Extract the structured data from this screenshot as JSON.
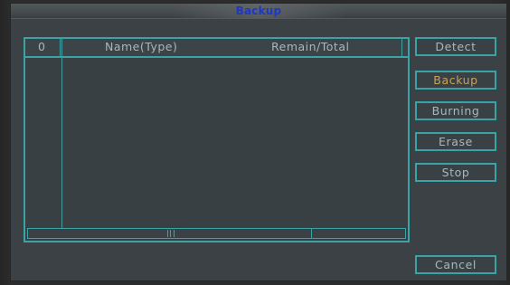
{
  "window": {
    "title": "Backup"
  },
  "device_list": {
    "columns": [
      "0",
      "Name(Type)",
      "Remain/Total"
    ],
    "rows": []
  },
  "buttons": {
    "detect": "Detect",
    "backup": "Backup",
    "burning": "Burning",
    "erase": "Erase",
    "stop": "Stop",
    "cancel": "Cancel"
  },
  "colors": {
    "accent_border": "#3aa3a6",
    "title_text": "#1f37c4",
    "label_text": "#a7b7bd",
    "focused_button_text": "#c9a15c"
  },
  "icons": {
    "scrollbar_grip": "grip-icon"
  }
}
